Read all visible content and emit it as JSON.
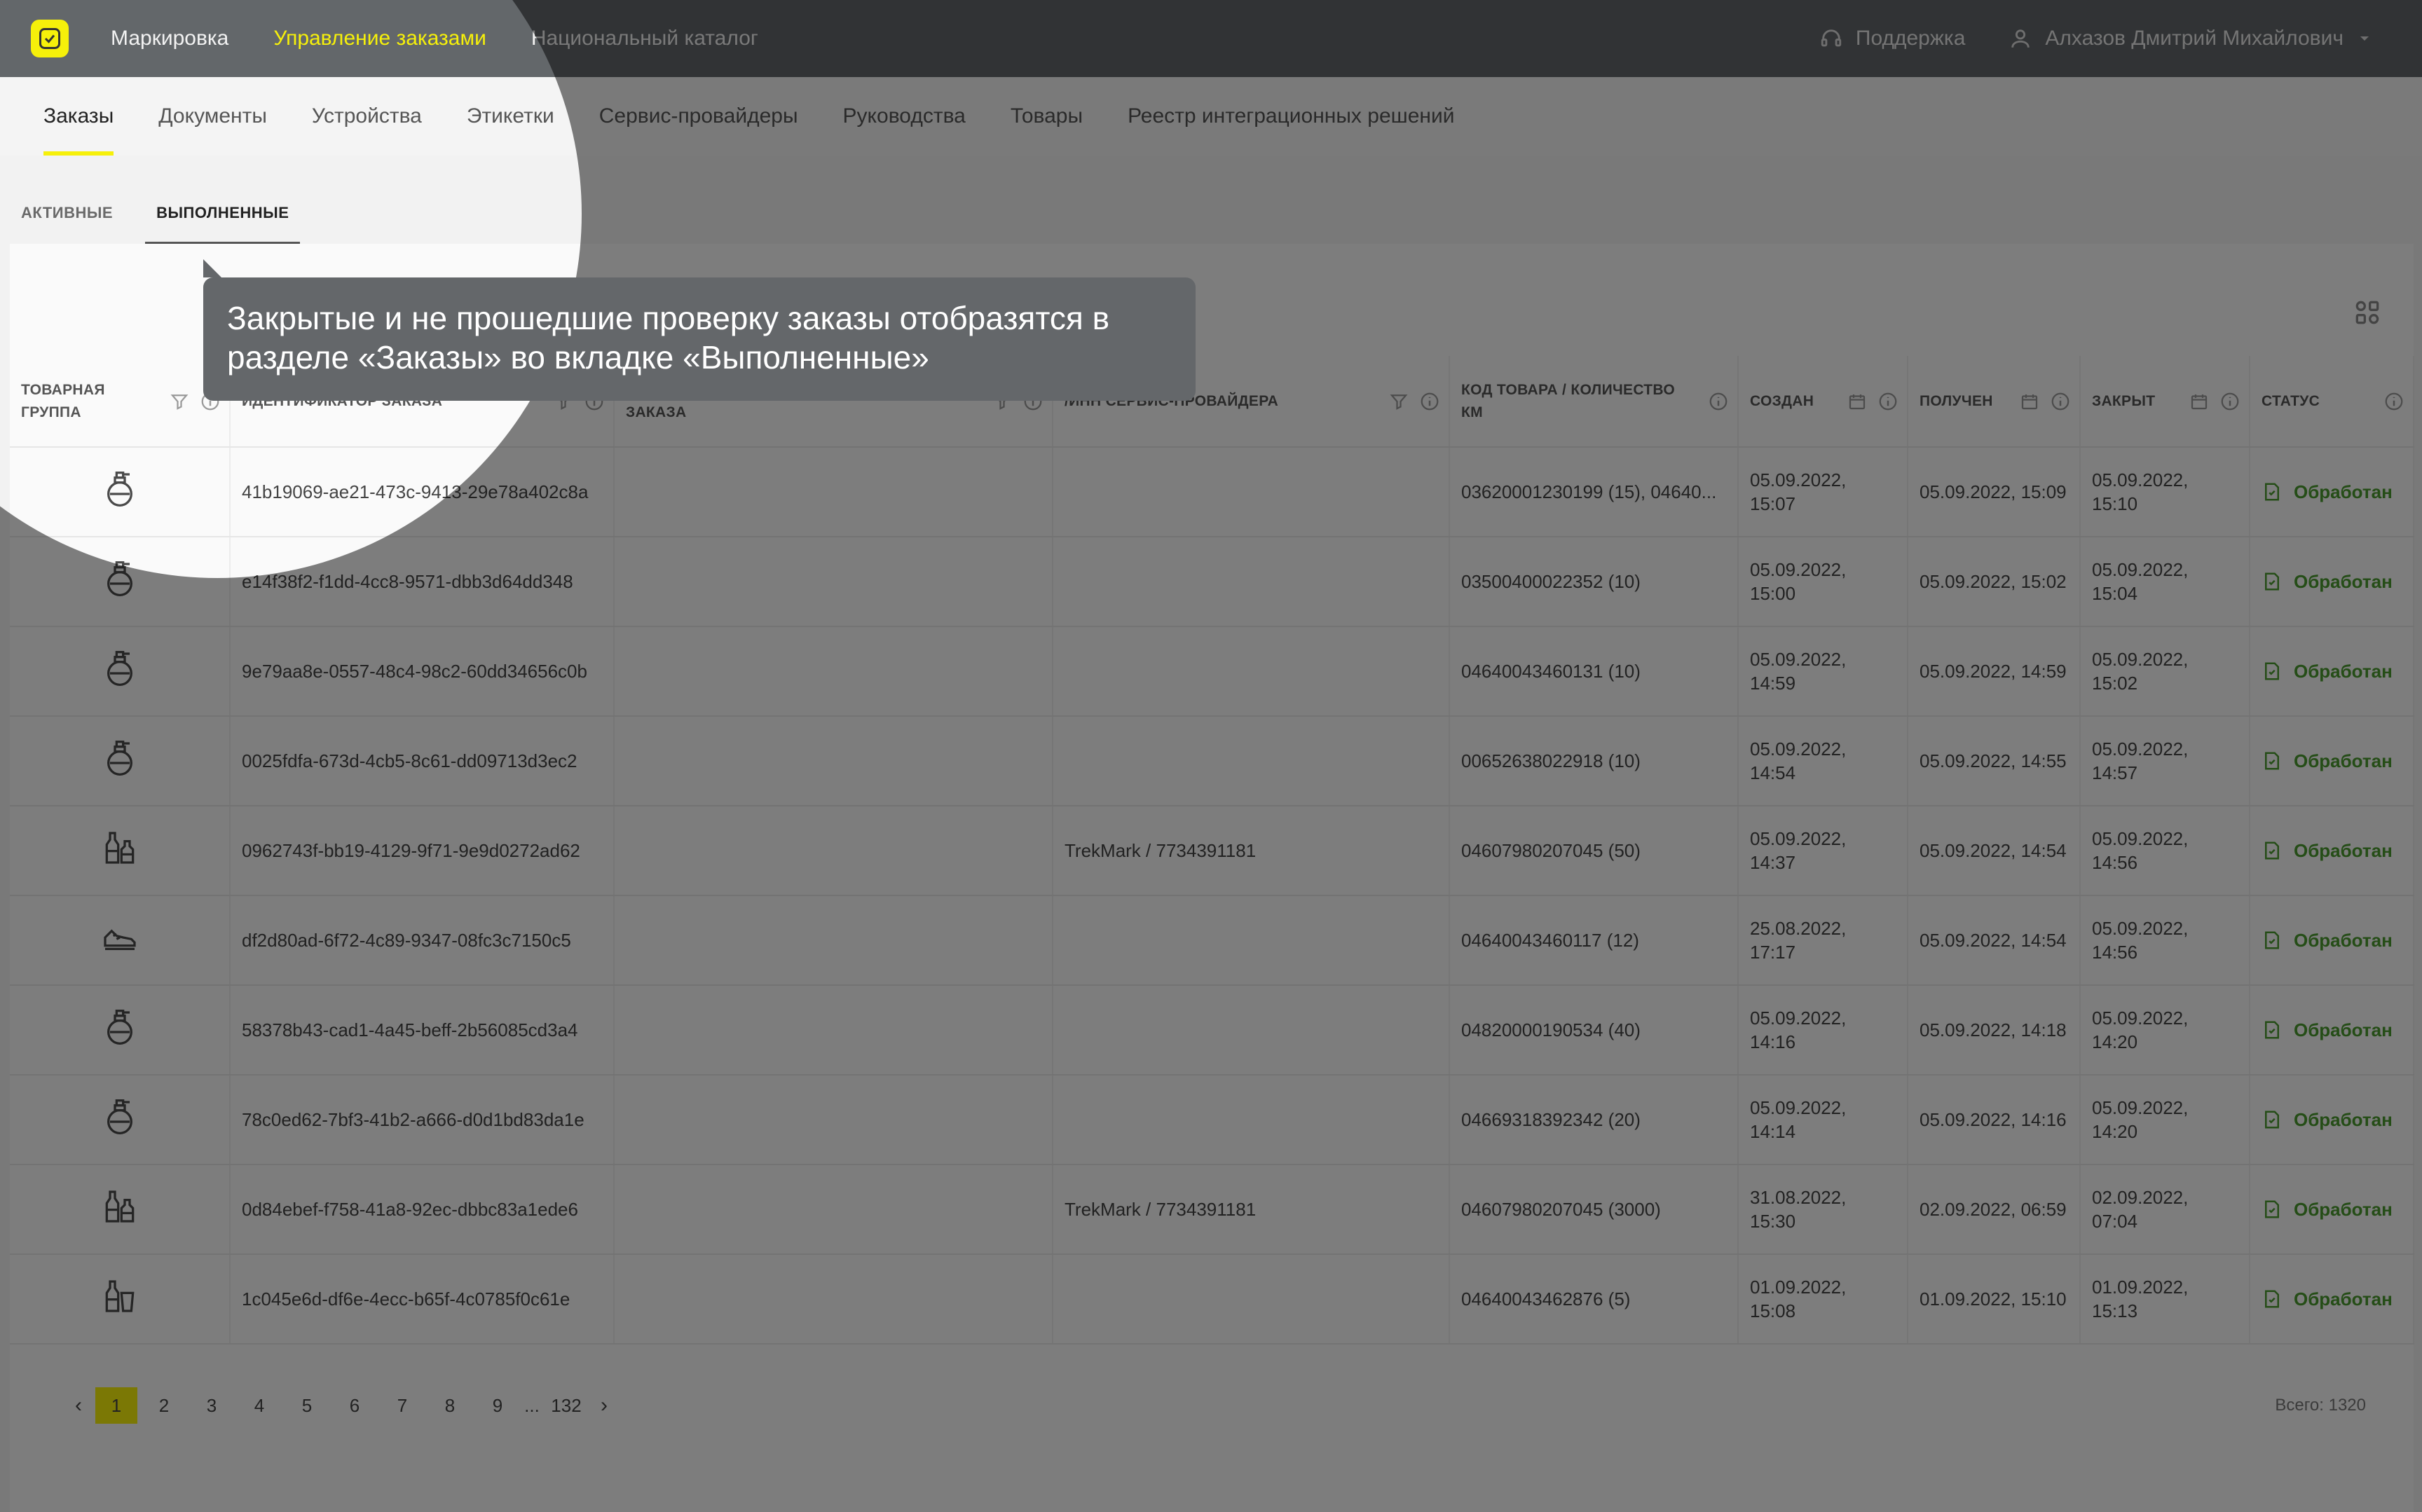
{
  "header": {
    "nav": [
      "Маркировка",
      "Управление заказами",
      "Национальный каталог"
    ],
    "active_index": 1,
    "support_label": "Поддержка",
    "user_name": "Алхазов Дмитрий Михайлович"
  },
  "subnav": {
    "tabs": [
      "Заказы",
      "Документы",
      "Устройства",
      "Этикетки",
      "Сервис-провайдеры",
      "Руководства",
      "Товары",
      "Реестр интеграционных решений"
    ],
    "active_index": 0
  },
  "status_tabs": {
    "active_label": "АКТИВНЫЕ",
    "done_label": "ВЫПОЛНЕННЫЕ"
  },
  "table": {
    "headers": {
      "group": "ТОВАРНАЯ ГРУППА",
      "order_id": "ИДЕНТИФИКАТОР ЗАКАЗА",
      "order_name": "ЗАКАЗА",
      "provider": "/ИНН СЕРВИС-ПРОВАЙДЕРА",
      "code": "КОД ТОВАРА / КОЛИЧЕСТВО КМ",
      "created": "СОЗДАН",
      "received": "ПОЛУЧЕН",
      "closed": "ЗАКРЫТ",
      "status": "СТАТУС"
    },
    "rows": [
      {
        "icon": "perfume-icon",
        "id": "41b19069-ae21-473c-9413-29e78a402c8a",
        "provider": "",
        "code": "03620001230199 (15), 04640...",
        "created": "05.09.2022, 15:07",
        "received": "05.09.2022, 15:09",
        "closed": "05.09.2022, 15:10",
        "status": "Обработан"
      },
      {
        "icon": "perfume-icon",
        "id": "e14f38f2-f1dd-4cc8-9571-dbb3d64dd348",
        "provider": "",
        "code": "03500400022352 (10)",
        "created": "05.09.2022, 15:00",
        "received": "05.09.2022, 15:02",
        "closed": "05.09.2022, 15:04",
        "status": "Обработан"
      },
      {
        "icon": "perfume-icon",
        "id": "9e79aa8e-0557-48c4-98c2-60dd34656c0b",
        "provider": "",
        "code": "04640043460131 (10)",
        "created": "05.09.2022, 14:59",
        "received": "05.09.2022, 14:59",
        "closed": "05.09.2022, 15:02",
        "status": "Обработан"
      },
      {
        "icon": "perfume-icon",
        "id": "0025fdfa-673d-4cb5-8c61-dd09713d3ec2",
        "provider": "",
        "code": "00652638022918 (10)",
        "created": "05.09.2022, 14:54",
        "received": "05.09.2022, 14:55",
        "closed": "05.09.2022, 14:57",
        "status": "Обработан"
      },
      {
        "icon": "bottles-icon",
        "id": "0962743f-bb19-4129-9f71-9e9d0272ad62",
        "provider": "TrekMark / 7734391181",
        "code": "04607980207045 (50)",
        "created": "05.09.2022, 14:37",
        "received": "05.09.2022, 14:54",
        "closed": "05.09.2022, 14:56",
        "status": "Обработан"
      },
      {
        "icon": "shoe-icon",
        "id": "df2d80ad-6f72-4c89-9347-08fc3c7150c5",
        "provider": "",
        "code": "04640043460117 (12)",
        "created": "25.08.2022, 17:17",
        "received": "05.09.2022, 14:54",
        "closed": "05.09.2022, 14:56",
        "status": "Обработан"
      },
      {
        "icon": "perfume-icon",
        "id": "58378b43-cad1-4a45-beff-2b56085cd3a4",
        "provider": "",
        "code": "04820000190534 (40)",
        "created": "05.09.2022, 14:16",
        "received": "05.09.2022, 14:18",
        "closed": "05.09.2022, 14:20",
        "status": "Обработан"
      },
      {
        "icon": "perfume-icon",
        "id": "78c0ed62-7bf3-41b2-a666-d0d1bd83da1e",
        "provider": "",
        "code": "04669318392342 (20)",
        "created": "05.09.2022, 14:14",
        "received": "05.09.2022, 14:16",
        "closed": "05.09.2022, 14:20",
        "status": "Обработан"
      },
      {
        "icon": "bottles-icon",
        "id": "0d84ebef-f758-41a8-92ec-dbbc83a1ede6",
        "provider": "TrekMark / 7734391181",
        "code": "04607980207045 (3000)",
        "created": "31.08.2022, 15:30",
        "received": "02.09.2022, 06:59",
        "closed": "02.09.2022, 07:04",
        "status": "Обработан"
      },
      {
        "icon": "bottle-glass-icon",
        "id": "1c045e6d-df6e-4ecc-b65f-4c0785f0c61e",
        "provider": "",
        "code": "04640043462876 (5)",
        "created": "01.09.2022, 15:08",
        "received": "01.09.2022, 15:10",
        "closed": "01.09.2022, 15:13",
        "status": "Обработан"
      }
    ]
  },
  "pagination": {
    "pages": [
      "1",
      "2",
      "3",
      "4",
      "5",
      "6",
      "7",
      "8",
      "9"
    ],
    "ellipsis": "...",
    "last": "132",
    "current": "1",
    "total_label": "Всего: 1320"
  },
  "tooltip": {
    "text_line1": "Закрытые и не прошедшие проверку заказы отобразятся в",
    "text_line2": "разделе «Заказы» во вкладке «Выполненные»"
  },
  "colors": {
    "accent": "#f6f00a",
    "topbar": "#63676a",
    "status_ok": "#4a9a2e"
  }
}
